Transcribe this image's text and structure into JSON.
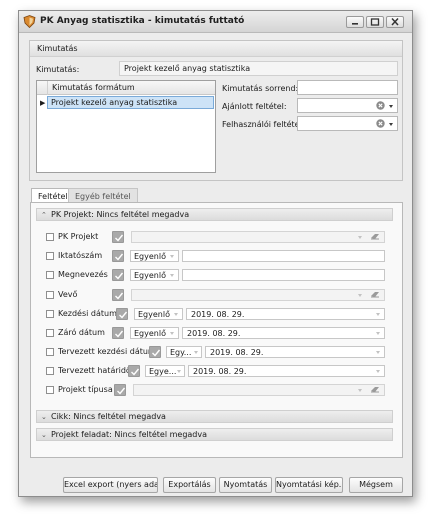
{
  "window": {
    "title": "PK Anyag statisztika - kimutatás futtató",
    "controls": [
      "minimize-icon",
      "maximize-icon",
      "close-icon"
    ]
  },
  "kimutatas_group": {
    "header": "Kimutatás",
    "kimutatas_label": "Kimutatás:",
    "kimutatas_value": "Projekt kezelő anyag statisztika",
    "grid": {
      "column_header": "Kimutatás formátum",
      "rows": [
        "Projekt kezelő anyag statisztika"
      ]
    },
    "sorrend_label": "Kimutatás sorrend:",
    "sorrend_value": "",
    "ajanlott_label": "Ajánlott feltétel:",
    "ajanlott_value": "",
    "felhasznaloi_label": "Felhasználói feltétel:",
    "felhasznaloi_value": ""
  },
  "tabs": [
    {
      "label": "Feltétel",
      "active": true
    },
    {
      "label": "Egyéb feltétel",
      "active": false
    }
  ],
  "sections": {
    "projekt": "PK Projekt: Nincs feltétel megadva",
    "cikk": "Cikk: Nincs feltétel megadva",
    "projekt_feladat": "Projekt feladat: Nincs feltétel megadva"
  },
  "conditions": [
    {
      "label": "PK Projekt",
      "operator": "",
      "value": "",
      "kind": "lookup"
    },
    {
      "label": "Iktatószám",
      "operator": "Egyenlő",
      "value": "",
      "kind": "text"
    },
    {
      "label": "Megnevezés",
      "operator": "Egyenlő",
      "value": "",
      "kind": "text"
    },
    {
      "label": "Vevő",
      "operator": "",
      "value": "",
      "kind": "lookup"
    },
    {
      "label": "Kezdési dátum",
      "operator": "Egyenlő",
      "value": "2019. 08. 29.",
      "kind": "date"
    },
    {
      "label": "Záró dátum",
      "operator": "Egyenlő",
      "value": "2019. 08. 29.",
      "kind": "date"
    },
    {
      "label": "Tervezett kezdési dátum",
      "operator": "Egy...",
      "value": "2019. 08. 29.",
      "kind": "date"
    },
    {
      "label": "Tervezett határidő",
      "operator": "Egye...",
      "value": "2019. 08. 29.",
      "kind": "date"
    },
    {
      "label": "Projekt típusa",
      "operator": "",
      "value": "",
      "kind": "lookup"
    }
  ],
  "buttons": {
    "excel_export": "Excel export (nyers adat)",
    "export": "Exportálás",
    "print": "Nyomtatás",
    "print_preview": "Nyomtatási kép...",
    "cancel": "Mégsem"
  }
}
